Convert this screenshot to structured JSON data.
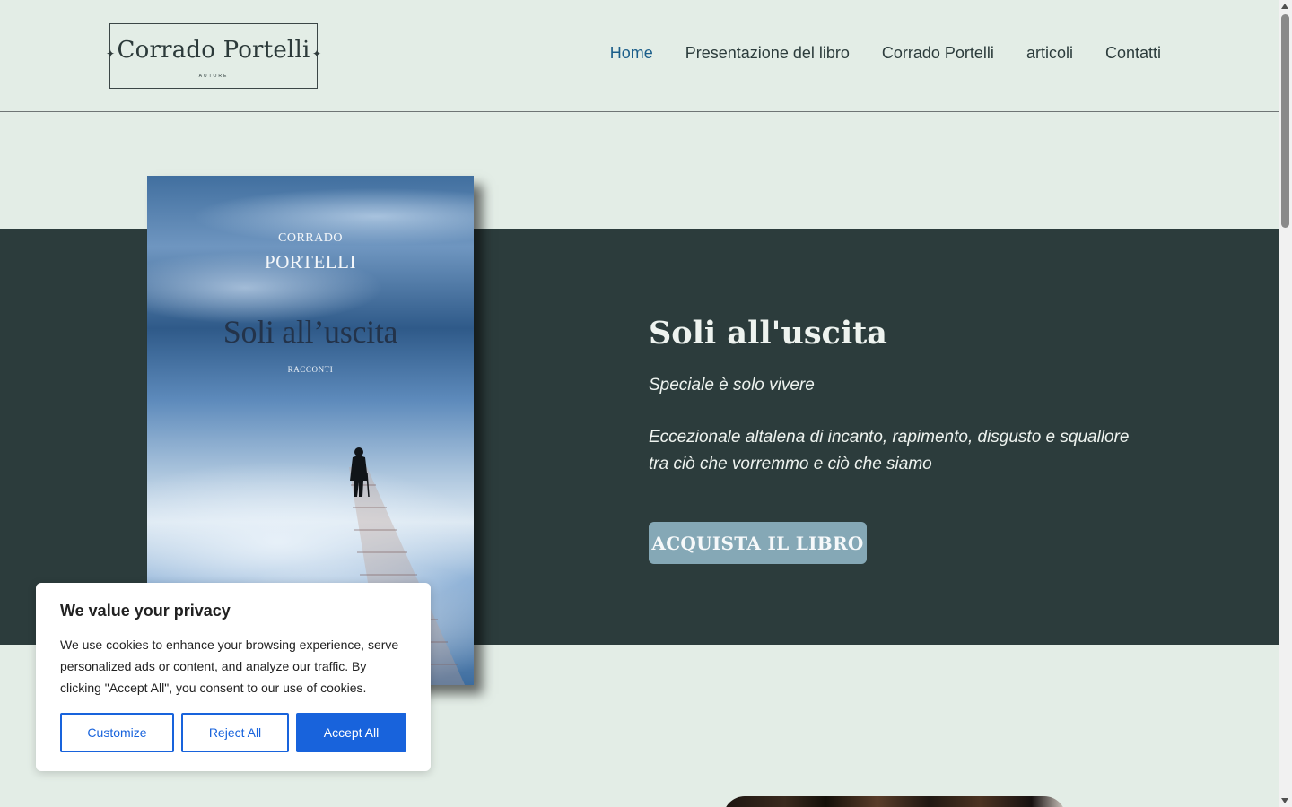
{
  "header": {
    "logo": {
      "name": "Corrado Portelli",
      "subtitle": "AUTORE"
    },
    "nav": [
      {
        "label": "Home",
        "active": true
      },
      {
        "label": "Presentazione del libro",
        "active": false
      },
      {
        "label": "Corrado Portelli",
        "active": false
      },
      {
        "label": "articoli",
        "active": false
      },
      {
        "label": "Contatti",
        "active": false
      }
    ]
  },
  "hero": {
    "cover": {
      "author_first": "CORRADO",
      "author_last": "PORTELLI",
      "title": "Soli all’uscita",
      "genre": "RACCONTI"
    },
    "title": "Soli all'uscita",
    "tagline": "Speciale è solo vivere",
    "description": "Eccezionale altalena di incanto, rapimento, disgusto e squallore tra ciò che vorremmo e ciò che siamo",
    "button_label": "ACQUISTA IL LIBRO"
  },
  "cookie_banner": {
    "title": "We value your privacy",
    "text": "We use cookies to enhance your browsing experience, serve personalized ads or content, and analyze our traffic. By clicking \"Accept All\", you consent to our use of cookies.",
    "customize_label": "Customize",
    "reject_label": "Reject All",
    "accept_label": "Accept All"
  },
  "colors": {
    "background": "#e3ede6",
    "hero_band": "#2c3c3c",
    "nav_active": "#1b5e8a",
    "button": "#85a8b6",
    "cookie_accent": "#1863dc"
  }
}
